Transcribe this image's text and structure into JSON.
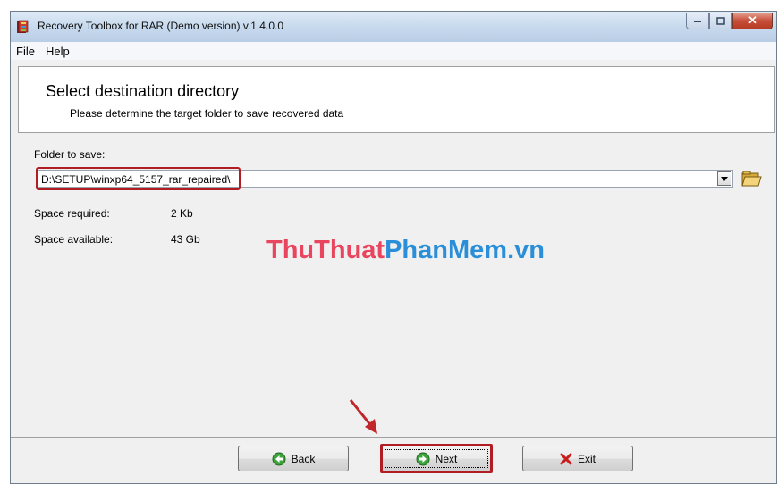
{
  "window": {
    "title": "Recovery Toolbox for RAR (Demo version) v.1.4.0.0",
    "caption": {
      "minimize_icon": "minimize-icon",
      "maximize_icon": "maximize-icon",
      "close_icon": "close-icon",
      "close_label": "✕"
    }
  },
  "menu": [
    "File",
    "Help"
  ],
  "header": {
    "title": "Select destination directory",
    "subtitle": "Please determine the target folder to save recovered data"
  },
  "folder": {
    "label": "Folder to save:",
    "value": "D:\\SETUP\\winxp64_5157_rar_repaired\\"
  },
  "space": {
    "required_label": "Space required:",
    "required_value": "2 Kb",
    "available_label": "Space available:",
    "available_value": "43 Gb"
  },
  "watermark": {
    "part1": "ThuThuat",
    "part2": "PhanMem",
    "part3": ".vn"
  },
  "buttons": {
    "back": "Back",
    "next": "Next",
    "exit": "Exit"
  },
  "colors": {
    "highlight": "#b01e24",
    "watermark_red": "#e8455e",
    "watermark_blue": "#2a8fd8"
  }
}
